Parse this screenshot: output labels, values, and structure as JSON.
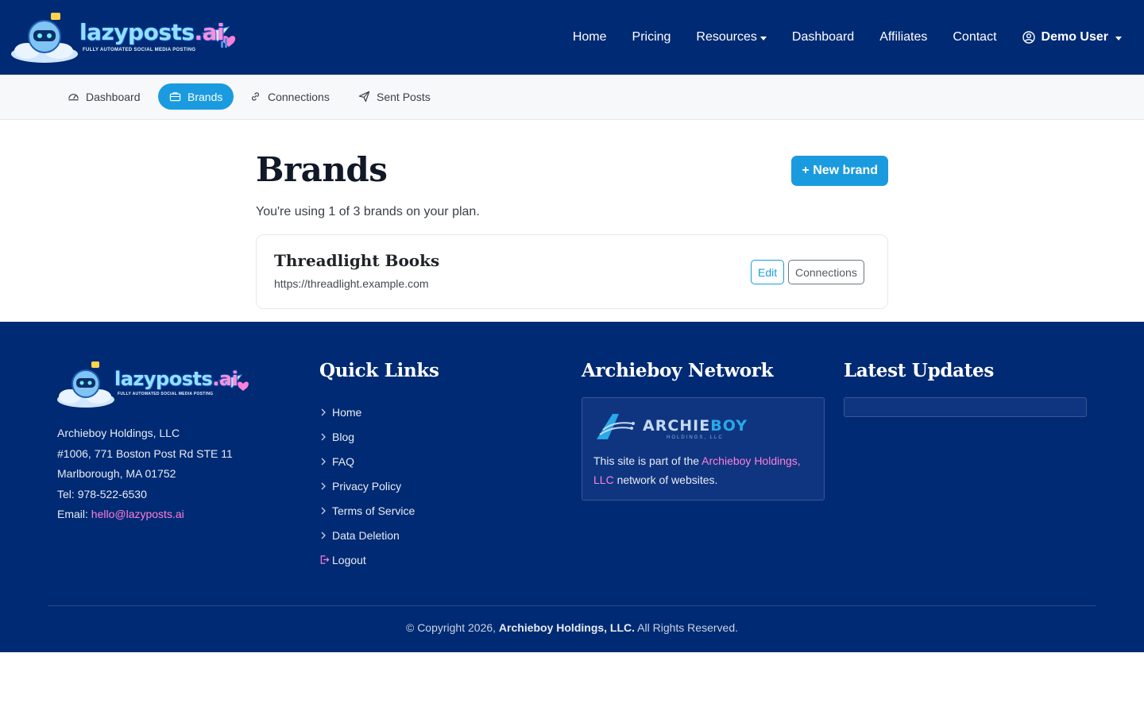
{
  "brand": {
    "logo_main": "lazyposts",
    "logo_ai": ".ai",
    "logo_tagline": "FULLY AUTOMATED SOCIAL MEDIA POSTING"
  },
  "nav": {
    "home": "Home",
    "pricing": "Pricing",
    "resources": "Resources",
    "dashboard": "Dashboard",
    "affiliates": "Affiliates",
    "contact": "Contact",
    "user": "Demo User"
  },
  "subnav": {
    "dashboard": "Dashboard",
    "brands": "Brands",
    "connections": "Connections",
    "sent_posts": "Sent Posts"
  },
  "main": {
    "title": "Brands",
    "new_brand": "+ New brand",
    "usage": "You're using 1 of 3 brands on your plan.",
    "brands": [
      {
        "name": "Threadlight Books",
        "url": "https://threadlight.example.com",
        "edit_label": "Edit",
        "connections_label": "Connections"
      }
    ]
  },
  "footer": {
    "company": "Archieboy Holdings, LLC",
    "address1": "#1006, 771 Boston Post Rd STE 11",
    "address2": "Marlborough, MA 01752",
    "tel_label": "Tel:",
    "tel": "978-522-6530",
    "email_label": "Email:",
    "email": "hello@lazyposts.ai",
    "quick_links_title": "Quick Links",
    "quick_links": [
      "Home",
      "Blog",
      "FAQ",
      "Privacy Policy",
      "Terms of Service",
      "Data Deletion"
    ],
    "logout": "Logout",
    "network_title": "Archieboy Network",
    "network_logo_a": "ARCHIE",
    "network_logo_b": "BOY",
    "network_logo_sub": "HOLDINGS, LLC",
    "network_text_before": "This site is part of the ",
    "network_link": "Archieboy Holdings, LLC",
    "network_text_after": " network of websites.",
    "updates_title": "Latest Updates",
    "copyright_before": "© Copyright 2026, ",
    "copyright_company": "Archieboy Holdings, LLC.",
    "copyright_after": " All Rights Reserved."
  },
  "colors": {
    "navy": "#002a73",
    "accent": "#1a9bdf",
    "link_pink": "#ff7fd9"
  }
}
